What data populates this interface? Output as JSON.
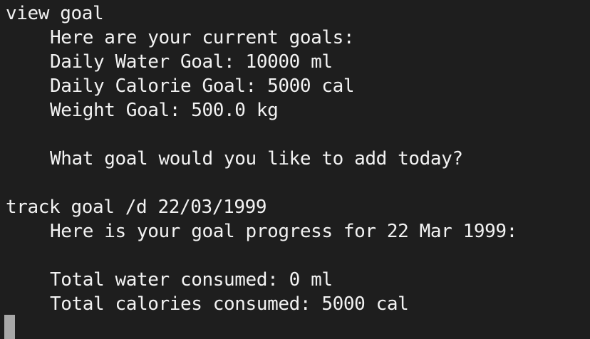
{
  "terminal": {
    "lines": [
      "view goal",
      "Here are your current goals:",
      "Daily Water Goal: 10000 ml",
      "Daily Calorie Goal: 5000 cal",
      "Weight Goal: 500.0 kg",
      "",
      "What goal would you like to add today?",
      "",
      "track goal /d 22/03/1999",
      "Here is your goal progress for 22 Mar 1999:",
      "",
      "Total water consumed: 0 ml",
      "Total calories consumed: 5000 cal"
    ]
  },
  "colors": {
    "background": "#1e1e1e",
    "text": "#f2f2f2",
    "cursor": "#a8a8a8"
  }
}
